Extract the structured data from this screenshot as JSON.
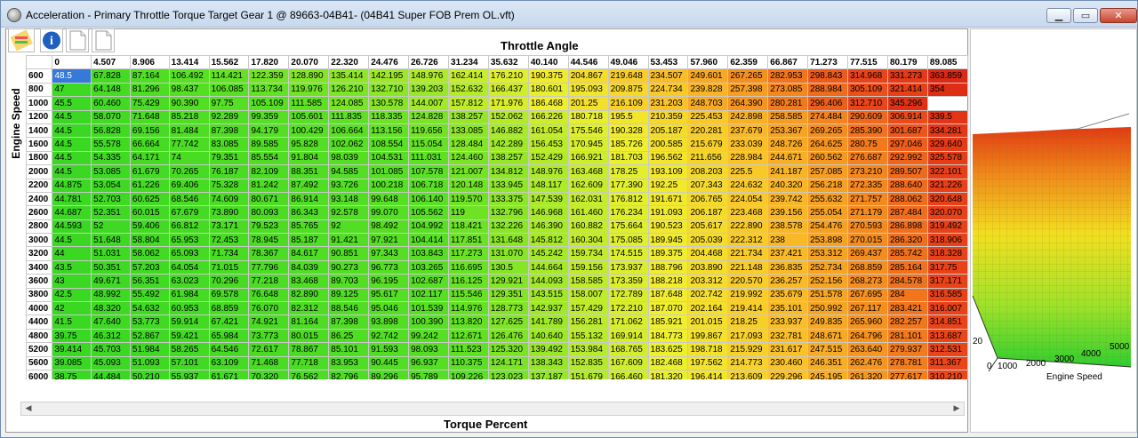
{
  "window": {
    "title": "Acceleration - Primary Throttle Torque Target Gear 1 @ 89663-04B41- (04B41 Super FOB Prem OL.vft)",
    "minimize": "▁",
    "restore": "▭",
    "close": "✕"
  },
  "toolbar": {
    "icons": [
      "chart-icon",
      "info-icon",
      "page-icon",
      "page-icon"
    ]
  },
  "table": {
    "x_axis_label": "Throttle Angle",
    "y_axis_label": "Engine Speed",
    "bottom_label": "Torque Percent",
    "columns": [
      "0",
      "4.507",
      "8.906",
      "13.414",
      "15.562",
      "17.820",
      "20.070",
      "22.320",
      "24.476",
      "26.726",
      "31.234",
      "35.632",
      "40.140",
      "44.546",
      "49.046",
      "53.453",
      "57.960",
      "62.359",
      "66.867",
      "71.273",
      "77.515",
      "80.179",
      "89.085"
    ],
    "rows": [
      {
        "rpm": "600",
        "v": [
          "48.5",
          "67.828",
          "87.164",
          "106.492",
          "114.421",
          "122.359",
          "128.890",
          "135.414",
          "142.195",
          "148.976",
          "162.414",
          "176.210",
          "190.375",
          "204.867",
          "219.648",
          "234.507",
          "249.601",
          "267.265",
          "282.953",
          "298.843",
          "314.968",
          "331.273",
          "363.859"
        ]
      },
      {
        "rpm": "800",
        "v": [
          "47",
          "64.148",
          "81.296",
          "98.437",
          "106.085",
          "113.734",
          "119.976",
          "126.210",
          "132.710",
          "139.203",
          "152.632",
          "166.437",
          "180.601",
          "195.093",
          "209.875",
          "224.734",
          "239.828",
          "257.398",
          "273.085",
          "288.984",
          "305.109",
          "321.414",
          "354"
        ]
      },
      {
        "rpm": "1000",
        "v": [
          "45.5",
          "60.460",
          "75.429",
          "90.390",
          "97.75",
          "105.109",
          "111.585",
          "124.085",
          "130.578",
          "144.007",
          "157.812",
          "171.976",
          "186.468",
          "201.25",
          "216.109",
          "231.203",
          "248.703",
          "264.390",
          "280.281",
          "296.406",
          "312.710",
          "345.296"
        ]
      },
      {
        "rpm": "1200",
        "v": [
          "44.5",
          "58.070",
          "71.648",
          "85.218",
          "92.289",
          "99.359",
          "105.601",
          "111.835",
          "118.335",
          "124.828",
          "138.257",
          "152.062",
          "166.226",
          "180.718",
          "195.5",
          "210.359",
          "225.453",
          "242.898",
          "258.585",
          "274.484",
          "290.609",
          "306.914",
          "339.5"
        ]
      },
      {
        "rpm": "1400",
        "v": [
          "44.5",
          "56.828",
          "69.156",
          "81.484",
          "87.398",
          "94.179",
          "100.429",
          "106.664",
          "113.156",
          "119.656",
          "133.085",
          "146.882",
          "161.054",
          "175.546",
          "190.328",
          "205.187",
          "220.281",
          "237.679",
          "253.367",
          "269.265",
          "285.390",
          "301.687",
          "334.281"
        ]
      },
      {
        "rpm": "1600",
        "v": [
          "44.5",
          "55.578",
          "66.664",
          "77.742",
          "83.085",
          "89.585",
          "95.828",
          "102.062",
          "108.554",
          "115.054",
          "128.484",
          "142.289",
          "156.453",
          "170.945",
          "185.726",
          "200.585",
          "215.679",
          "233.039",
          "248.726",
          "264.625",
          "280.75",
          "297.046",
          "329.640"
        ]
      },
      {
        "rpm": "1800",
        "v": [
          "44.5",
          "54.335",
          "64.171",
          "74",
          "79.351",
          "85.554",
          "91.804",
          "98.039",
          "104.531",
          "111.031",
          "124.460",
          "138.257",
          "152.429",
          "166.921",
          "181.703",
          "196.562",
          "211.656",
          "228.984",
          "244.671",
          "260.562",
          "276.687",
          "292.992",
          "325.578"
        ]
      },
      {
        "rpm": "2000",
        "v": [
          "44.5",
          "53.085",
          "61.679",
          "70.265",
          "76.187",
          "82.109",
          "88.351",
          "94.585",
          "101.085",
          "107.578",
          "121.007",
          "134.812",
          "148.976",
          "163.468",
          "178.25",
          "193.109",
          "208.203",
          "225.5",
          "241.187",
          "257.085",
          "273.210",
          "289.507",
          "322.101"
        ]
      },
      {
        "rpm": "2200",
        "v": [
          "44.875",
          "53.054",
          "61.226",
          "69.406",
          "75.328",
          "81.242",
          "87.492",
          "93.726",
          "100.218",
          "106.718",
          "120.148",
          "133.945",
          "148.117",
          "162.609",
          "177.390",
          "192.25",
          "207.343",
          "224.632",
          "240.320",
          "256.218",
          "272.335",
          "288.640",
          "321.226"
        ]
      },
      {
        "rpm": "2400",
        "v": [
          "44.781",
          "52.703",
          "60.625",
          "68.546",
          "74.609",
          "80.671",
          "86.914",
          "93.148",
          "99.648",
          "106.140",
          "119.570",
          "133.375",
          "147.539",
          "162.031",
          "176.812",
          "191.671",
          "206.765",
          "224.054",
          "239.742",
          "255.632",
          "271.757",
          "288.062",
          "320.648"
        ]
      },
      {
        "rpm": "2600",
        "v": [
          "44.687",
          "52.351",
          "60.015",
          "67.679",
          "73.890",
          "80.093",
          "86.343",
          "92.578",
          "99.070",
          "105.562",
          "119",
          "132.796",
          "146.968",
          "161.460",
          "176.234",
          "191.093",
          "206.187",
          "223.468",
          "239.156",
          "255.054",
          "271.179",
          "287.484",
          "320.070"
        ]
      },
      {
        "rpm": "2800",
        "v": [
          "44.593",
          "52",
          "59.406",
          "66.812",
          "73.171",
          "79.523",
          "85.765",
          "92",
          "98.492",
          "104.992",
          "118.421",
          "132.226",
          "146.390",
          "160.882",
          "175.664",
          "190.523",
          "205.617",
          "222.890",
          "238.578",
          "254.476",
          "270.593",
          "286.898",
          "319.492"
        ]
      },
      {
        "rpm": "3000",
        "v": [
          "44.5",
          "51.648",
          "58.804",
          "65.953",
          "72.453",
          "78.945",
          "85.187",
          "91.421",
          "97.921",
          "104.414",
          "117.851",
          "131.648",
          "145.812",
          "160.304",
          "175.085",
          "189.945",
          "205.039",
          "222.312",
          "238",
          "253.898",
          "270.015",
          "286.320",
          "318.906"
        ]
      },
      {
        "rpm": "3200",
        "v": [
          "44",
          "51.031",
          "58.062",
          "65.093",
          "71.734",
          "78.367",
          "84.617",
          "90.851",
          "97.343",
          "103.843",
          "117.273",
          "131.070",
          "145.242",
          "159.734",
          "174.515",
          "189.375",
          "204.468",
          "221.734",
          "237.421",
          "253.312",
          "269.437",
          "285.742",
          "318.328"
        ]
      },
      {
        "rpm": "3400",
        "v": [
          "43.5",
          "50.351",
          "57.203",
          "64.054",
          "71.015",
          "77.796",
          "84.039",
          "90.273",
          "96.773",
          "103.265",
          "116.695",
          "130.5",
          "144.664",
          "159.156",
          "173.937",
          "188.796",
          "203.890",
          "221.148",
          "236.835",
          "252.734",
          "268.859",
          "285.164",
          "317.75"
        ]
      },
      {
        "rpm": "3600",
        "v": [
          "43",
          "49.671",
          "56.351",
          "63.023",
          "70.296",
          "77.218",
          "83.468",
          "89.703",
          "96.195",
          "102.687",
          "116.125",
          "129.921",
          "144.093",
          "158.585",
          "173.359",
          "188.218",
          "203.312",
          "220.570",
          "236.257",
          "252.156",
          "268.273",
          "284.578",
          "317.171"
        ]
      },
      {
        "rpm": "3800",
        "v": [
          "42.5",
          "48.992",
          "55.492",
          "61.984",
          "69.578",
          "76.648",
          "82.890",
          "89.125",
          "95.617",
          "102.117",
          "115.546",
          "129.351",
          "143.515",
          "158.007",
          "172.789",
          "187.648",
          "202.742",
          "219.992",
          "235.679",
          "251.578",
          "267.695",
          "284",
          "316.585"
        ]
      },
      {
        "rpm": "4000",
        "v": [
          "42",
          "48.320",
          "54.632",
          "60.953",
          "68.859",
          "76.070",
          "82.312",
          "88.546",
          "95.046",
          "101.539",
          "114.976",
          "128.773",
          "142.937",
          "157.429",
          "172.210",
          "187.070",
          "202.164",
          "219.414",
          "235.101",
          "250.992",
          "267.117",
          "283.421",
          "316.007"
        ]
      },
      {
        "rpm": "4400",
        "v": [
          "41.5",
          "47.640",
          "53.773",
          "59.914",
          "67.421",
          "74.921",
          "81.164",
          "87.398",
          "93.898",
          "100.390",
          "113.820",
          "127.625",
          "141.789",
          "156.281",
          "171.062",
          "185.921",
          "201.015",
          "218.25",
          "233.937",
          "249.835",
          "265.960",
          "282.257",
          "314.851"
        ]
      },
      {
        "rpm": "4800",
        "v": [
          "39.75",
          "46.312",
          "52.867",
          "59.421",
          "65.984",
          "73.773",
          "80.015",
          "86.25",
          "92.742",
          "99.242",
          "112.671",
          "126.476",
          "140.640",
          "155.132",
          "169.914",
          "184.773",
          "199.867",
          "217.093",
          "232.781",
          "248.671",
          "264.796",
          "281.101",
          "313.687"
        ]
      },
      {
        "rpm": "5200",
        "v": [
          "39.414",
          "45.703",
          "51.984",
          "58.265",
          "64.546",
          "72.617",
          "78.867",
          "85.101",
          "91.593",
          "98.093",
          "111.523",
          "125.320",
          "139.492",
          "153.984",
          "168.765",
          "183.625",
          "198.718",
          "215.929",
          "231.617",
          "247.515",
          "263.640",
          "279.937",
          "312.531"
        ]
      },
      {
        "rpm": "5600",
        "v": [
          "39.085",
          "45.093",
          "51.093",
          "57.101",
          "63.109",
          "71.468",
          "77.718",
          "83.953",
          "90.445",
          "96.937",
          "110.375",
          "124.171",
          "138.343",
          "152.835",
          "167.609",
          "182.468",
          "197.562",
          "214.773",
          "230.460",
          "246.351",
          "262.476",
          "278.781",
          "311.367"
        ]
      },
      {
        "rpm": "6000",
        "v": [
          "38.75",
          "44.484",
          "50.210",
          "55.937",
          "61.671",
          "70.320",
          "76.562",
          "82.796",
          "89.296",
          "95.789",
          "109.226",
          "123.023",
          "137.187",
          "151.679",
          "166.460",
          "181.320",
          "196.414",
          "213.609",
          "229.296",
          "245.195",
          "261.320",
          "277.617",
          "310.210"
        ]
      }
    ]
  },
  "graph": {
    "x_ticks": [
      "0",
      "1000",
      "2000",
      "3000",
      "4000",
      "5000"
    ],
    "z_tick": "20",
    "x_label": "Engine Speed"
  }
}
